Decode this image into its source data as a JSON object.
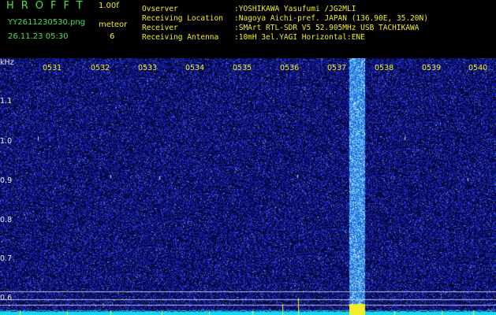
{
  "header": {
    "app_title": "HROFFT",
    "version": "1.00f",
    "filename": "YY2611230530.png",
    "datetime": "26.11.23 05:30",
    "meteor_label": "meteor",
    "meteor_count": "6"
  },
  "station_info": [
    {
      "key": "Ovserver",
      "value": ":YOSHIKAWA Yasufumi /JG2MLI"
    },
    {
      "key": "Receiving Location",
      "value": ":Nagoya Aichi-pref. JAPAN (136.90E, 35.20N)"
    },
    {
      "key": "Receiver",
      "value": ":SMArt RTL-SDR V5 52.905MHz USB TACHIKAWA"
    },
    {
      "key": "Receiving Antenna",
      "value": ":10mH 3el.YAGI Horizontal:ENE"
    }
  ],
  "spectrogram": {
    "unit_label": "kHz",
    "time_labels": [
      "0531",
      "0532",
      "0533",
      "0534",
      "0535",
      "0536",
      "0537",
      "0538",
      "0539",
      "0540"
    ],
    "freq_labels": [
      "1.1",
      "1.0",
      "0.9",
      "0.8",
      "0.7",
      "0.6"
    ],
    "colors": {
      "background": "#05053a",
      "noise": "#2a3fd0",
      "burst": "#6fd0ff",
      "trace": "#18d8f0",
      "signal": "#f2ee2a"
    }
  }
}
